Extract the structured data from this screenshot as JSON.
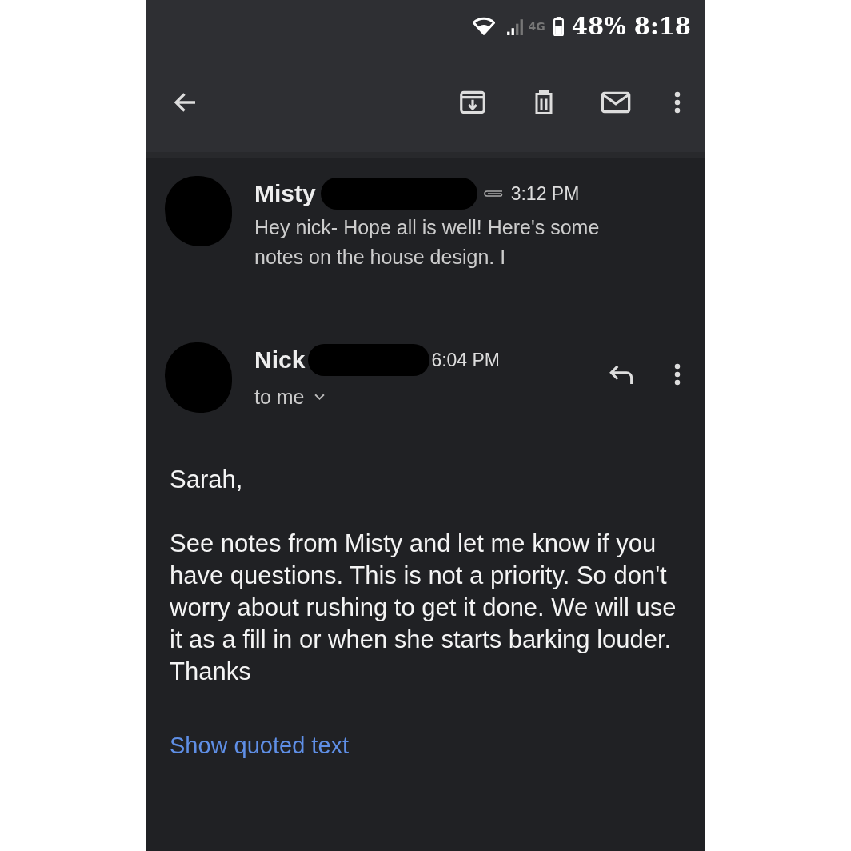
{
  "status_bar": {
    "network": "4G",
    "battery": "48%",
    "time": "8:18"
  },
  "messages": [
    {
      "kind": "collapsed",
      "sender": "Misty",
      "time": "3:12 PM",
      "attachment": true,
      "snippet": "Hey nick- Hope all is well! Here's some notes on the house design. I"
    },
    {
      "kind": "expanded",
      "sender": "Nick",
      "time": "6:04 PM",
      "recipient": "to me",
      "body": [
        "Sarah,",
        "See notes from Misty and let me know if you have questions. This is not a priority. So don't worry about rushing to get it done. We will use it as a fill in or when she starts barking louder.\nThanks"
      ],
      "quoted_link": "Show quoted text"
    }
  ]
}
